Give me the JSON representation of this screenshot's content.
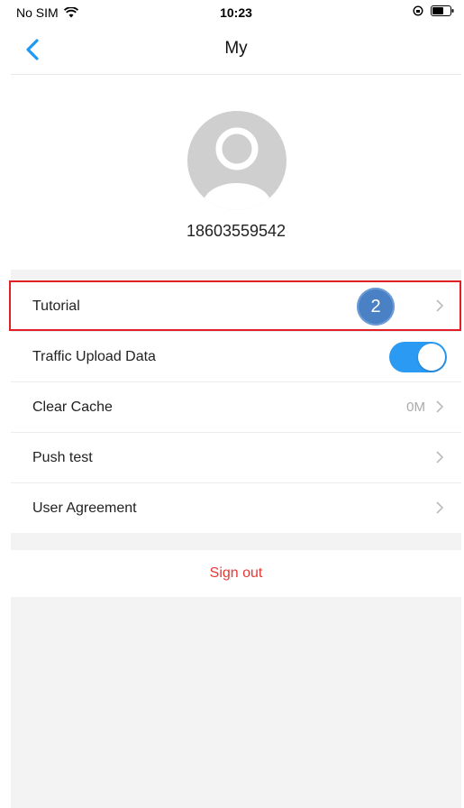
{
  "status_bar": {
    "carrier": "No SIM",
    "time": "10:23",
    "wifi_icon": "wifi-icon",
    "battery_icon": "battery-icon"
  },
  "nav": {
    "title": "My",
    "back_icon": "chevron-left-icon",
    "accent_color": "#1e9af5"
  },
  "profile": {
    "phone": "18603559542",
    "avatar_icon": "user-avatar-icon"
  },
  "menu": {
    "items": [
      {
        "label": "Tutorial",
        "type": "link"
      },
      {
        "label": "Traffic Upload Data",
        "type": "toggle",
        "on": true
      },
      {
        "label": "Clear Cache",
        "type": "link",
        "value": "0M"
      },
      {
        "label": "Push test",
        "type": "link"
      },
      {
        "label": "User Agreement",
        "type": "link"
      }
    ]
  },
  "annotation": {
    "badge": "2",
    "highlight_color": "#e41e26"
  },
  "signout": {
    "label": "Sign out",
    "color": "#e53935"
  }
}
